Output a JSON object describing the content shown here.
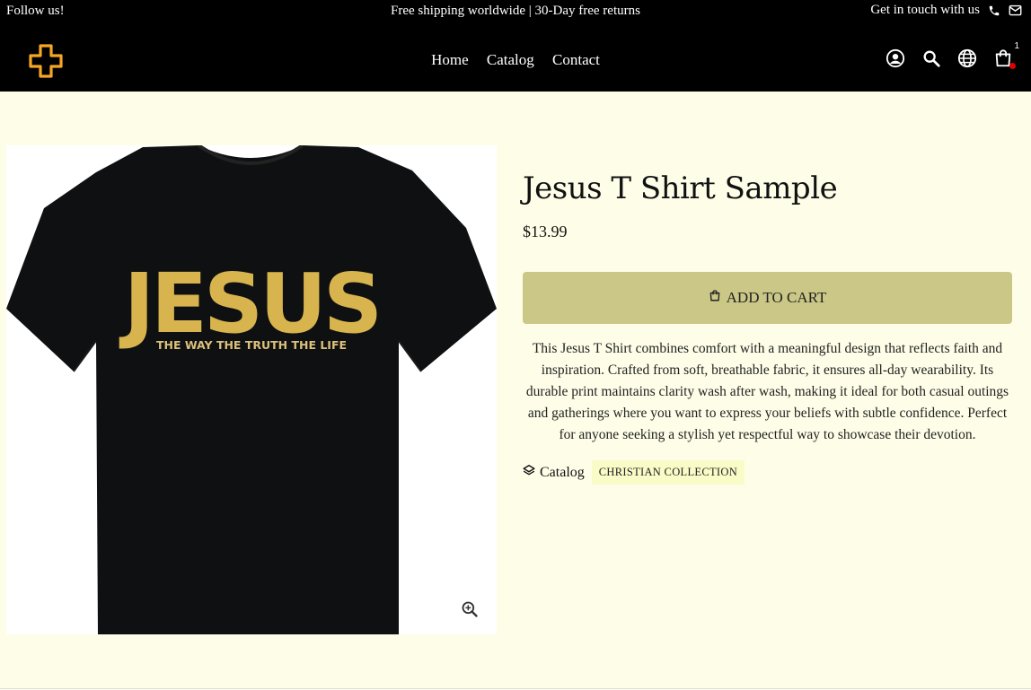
{
  "announcement": {
    "follow": "Follow us!",
    "center": "Free shipping worldwide | 30-Day free returns",
    "contact": "Get in touch with us"
  },
  "header": {
    "nav": [
      "Home",
      "Catalog",
      "Contact"
    ],
    "cart_count": "1",
    "logo_color": "#f5a623"
  },
  "product": {
    "image_text": {
      "word": "JESUS",
      "tagline": "THE WAY THE TRUTH THE LIFE"
    },
    "title": "Jesus T Shirt Sample",
    "price": "$13.99",
    "add_to_cart": "ADD TO CART",
    "description": "This Jesus T Shirt combines comfort with a meaningful design that reflects faith and inspiration. Crafted from soft, breathable fabric, it ensures all-day wearability. Its durable print maintains clarity wash after wash, making it ideal for both casual outings and gatherings where you want to express your beliefs with subtle confidence. Perfect for anyone seeking a stylish yet respectful way to showcase their devotion.",
    "catalog_label": "Catalog",
    "collection_tag": "CHRISTIAN COLLECTION"
  },
  "colors": {
    "button": "#cbc887",
    "background": "#fefee8",
    "cart_dot": "#e00000"
  }
}
